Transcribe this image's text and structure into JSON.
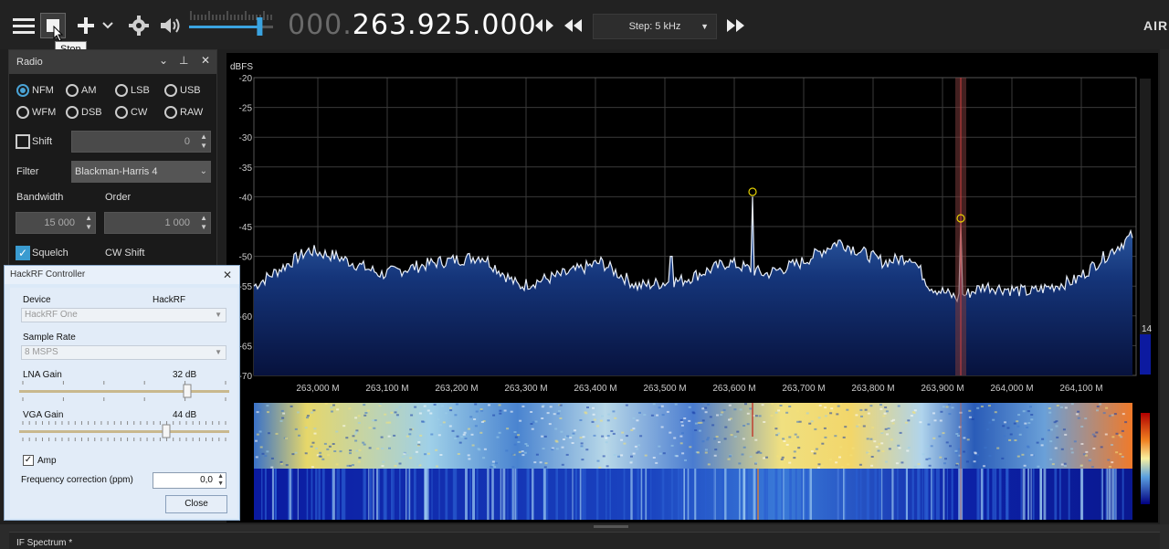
{
  "toolbar": {
    "frequency_dim": "000.",
    "frequency_main": "263.925.000",
    "step_label": "Step: 5 kHz",
    "tooltip": "Stop",
    "brand": "AIR",
    "volume_level": 0.9
  },
  "radio": {
    "title": "Radio",
    "modes": [
      {
        "label": "NFM",
        "selected": true
      },
      {
        "label": "AM",
        "selected": false
      },
      {
        "label": "LSB",
        "selected": false
      },
      {
        "label": "USB",
        "selected": false
      },
      {
        "label": "WFM",
        "selected": false
      },
      {
        "label": "DSB",
        "selected": false
      },
      {
        "label": "CW",
        "selected": false
      },
      {
        "label": "RAW",
        "selected": false
      }
    ],
    "shift_label": "Shift",
    "shift_value": "0",
    "filter_label": "Filter",
    "filter_value": "Blackman-Harris 4",
    "bandwidth_label": "Bandwidth",
    "order_label": "Order",
    "bandwidth_value": "15 000",
    "order_value": "1 000",
    "squelch_label": "Squelch",
    "cw_shift_label": "CW Shift"
  },
  "hackrf": {
    "title": "HackRF Controller",
    "device_label": "Device",
    "device_name": "HackRF",
    "device_value": "HackRF One",
    "sample_rate_label": "Sample Rate",
    "sample_rate_value": "8 MSPS",
    "lna_label": "LNA Gain",
    "lna_value": "32 dB",
    "lna_level": 0.8,
    "vga_label": "VGA Gain",
    "vga_value": "44 dB",
    "vga_level": 0.7,
    "amp_label": "Amp",
    "ppm_label": "Frequency correction (ppm)",
    "ppm_value": "0,0",
    "close_label": "Close"
  },
  "spectrum": {
    "ylabel": "dBFS",
    "ylim": [
      -70,
      -20
    ],
    "y_ticks": [
      "-20",
      "-25",
      "-30",
      "-35",
      "-40",
      "-45",
      "-50",
      "-55",
      "-60",
      "-65",
      "-70"
    ],
    "x_ticks": [
      "263,000 M",
      "263,100 M",
      "263,200 M",
      "263,300 M",
      "263,400 M",
      "263,500 M",
      "263,600 M",
      "263,700 M",
      "263,800 M",
      "263,900 M",
      "264,000 M",
      "264,100 M"
    ],
    "level_readout": "14"
  },
  "bottom": {
    "if_spectrum_label": "IF Spectrum *"
  }
}
